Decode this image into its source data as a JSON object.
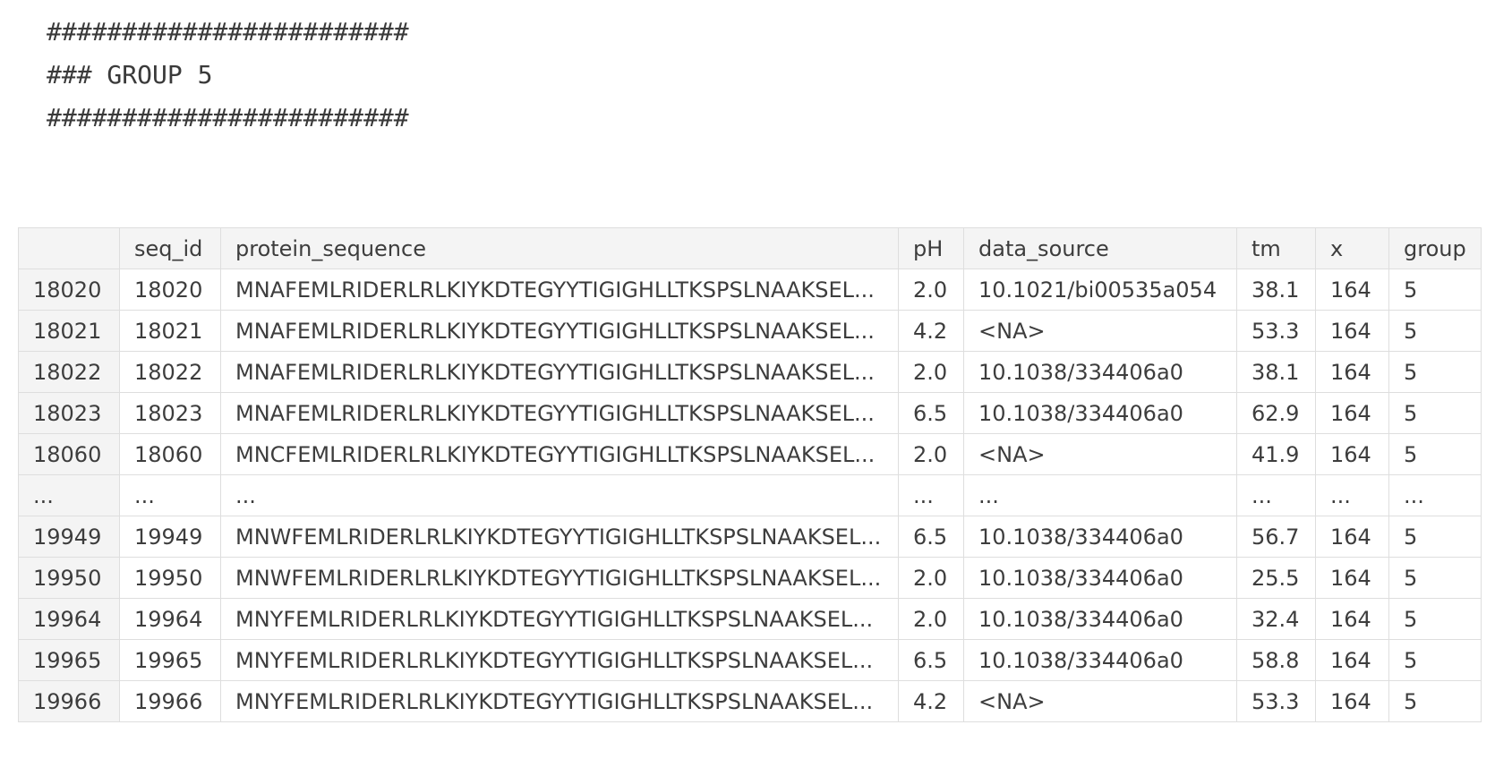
{
  "output": {
    "lines": [
      "########################",
      "### GROUP 5",
      "########################"
    ]
  },
  "dataframe": {
    "index_header": "",
    "columns": [
      "seq_id",
      "protein_sequence",
      "pH",
      "data_source",
      "tm",
      "x",
      "group"
    ],
    "rows": [
      {
        "index": "18020",
        "cells": [
          "18020",
          "MNAFEMLRIDERLRLKIYKDTEGYYTIGIGHLLTKSPSLNAAKSEL...",
          "2.0",
          "10.1021/bi00535a054",
          "38.1",
          "164",
          "5"
        ]
      },
      {
        "index": "18021",
        "cells": [
          "18021",
          "MNAFEMLRIDERLRLKIYKDTEGYYTIGIGHLLTKSPSLNAAKSEL...",
          "4.2",
          "<NA>",
          "53.3",
          "164",
          "5"
        ]
      },
      {
        "index": "18022",
        "cells": [
          "18022",
          "MNAFEMLRIDERLRLKIYKDTEGYYTIGIGHLLTKSPSLNAAKSEL...",
          "2.0",
          "10.1038/334406a0",
          "38.1",
          "164",
          "5"
        ]
      },
      {
        "index": "18023",
        "cells": [
          "18023",
          "MNAFEMLRIDERLRLKIYKDTEGYYTIGIGHLLTKSPSLNAAKSEL...",
          "6.5",
          "10.1038/334406a0",
          "62.9",
          "164",
          "5"
        ]
      },
      {
        "index": "18060",
        "cells": [
          "18060",
          "MNCFEMLRIDERLRLKIYKDTEGYYTIGIGHLLTKSPSLNAAKSEL...",
          "2.0",
          "<NA>",
          "41.9",
          "164",
          "5"
        ]
      },
      {
        "index": "...",
        "cells": [
          "...",
          "...",
          "...",
          "...",
          "...",
          "...",
          "..."
        ]
      },
      {
        "index": "19949",
        "cells": [
          "19949",
          "MNWFEMLRIDERLRLKIYKDTEGYYTIGIGHLLTKSPSLNAAKSEL...",
          "6.5",
          "10.1038/334406a0",
          "56.7",
          "164",
          "5"
        ]
      },
      {
        "index": "19950",
        "cells": [
          "19950",
          "MNWFEMLRIDERLRLKIYKDTEGYYTIGIGHLLTKSPSLNAAKSEL...",
          "2.0",
          "10.1038/334406a0",
          "25.5",
          "164",
          "5"
        ]
      },
      {
        "index": "19964",
        "cells": [
          "19964",
          "MNYFEMLRIDERLRLKIYKDTEGYYTIGIGHLLTKSPSLNAAKSEL...",
          "2.0",
          "10.1038/334406a0",
          "32.4",
          "164",
          "5"
        ]
      },
      {
        "index": "19965",
        "cells": [
          "19965",
          "MNYFEMLRIDERLRLKIYKDTEGYYTIGIGHLLTKSPSLNAAKSEL...",
          "6.5",
          "10.1038/334406a0",
          "58.8",
          "164",
          "5"
        ]
      },
      {
        "index": "19966",
        "cells": [
          "19966",
          "MNYFEMLRIDERLRLKIYKDTEGYYTIGIGHLLTKSPSLNAAKSEL...",
          "4.2",
          "<NA>",
          "53.3",
          "164",
          "5"
        ]
      }
    ]
  }
}
